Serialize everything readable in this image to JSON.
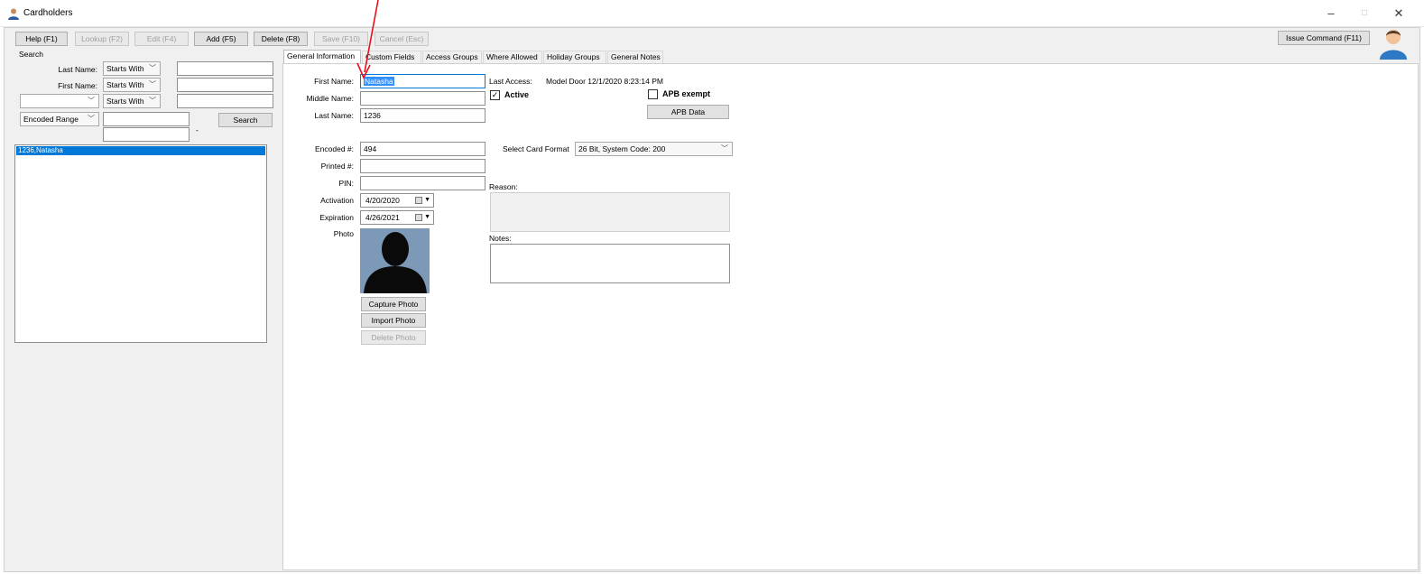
{
  "window": {
    "title": "Cardholders",
    "minimize": "–",
    "maximize": "□",
    "close": "✕"
  },
  "toolbar": {
    "help": "Help (F1)",
    "lookup": "Lookup (F2)",
    "edit": "Edit (F4)",
    "add": "Add (F5)",
    "delete": "Delete (F8)",
    "save": "Save (F10)",
    "cancel": "Cancel (Esc)",
    "issue_command": "Issue Command (F11)"
  },
  "search": {
    "group_label": "Search",
    "last_name_label": "Last Name:",
    "first_name_label": "First Name:",
    "starts_with": "Starts With",
    "encoded_range": "Encoded Range",
    "range_dash": "-",
    "search_button": "Search",
    "results": [
      "1236,Natasha"
    ]
  },
  "tabs": [
    "General Information",
    "Custom Fields",
    "Access Groups",
    "Where Allowed",
    "Holiday Groups",
    "General Notes"
  ],
  "form": {
    "first_name_label": "First Name:",
    "first_name_value": "Natasha",
    "middle_name_label": "Middle Name:",
    "middle_name_value": "",
    "last_name_label": "Last Name:",
    "last_name_value": "1236",
    "encoded_label": "Encoded #:",
    "encoded_value": "494",
    "printed_label": "Printed #:",
    "printed_value": "",
    "pin_label": "PIN:",
    "pin_value": "",
    "activation_label": "Activation",
    "activation_value": "4/20/2020",
    "expiration_label": "Expiration",
    "expiration_value": "4/26/2021",
    "photo_label": "Photo",
    "capture_photo": "Capture Photo",
    "import_photo": "Import Photo",
    "delete_photo": "Delete Photo",
    "last_access_label": "Last Access:",
    "last_access_value": "Model Door 12/1/2020 8:23:14 PM",
    "active_label": "Active",
    "active_checked": true,
    "apb_exempt_label": "APB exempt",
    "apb_exempt_checked": false,
    "apb_data_button": "APB Data",
    "select_card_format_label": "Select Card Format",
    "card_format_value": "26 Bit, System Code: 200",
    "reason_label": "Reason:",
    "notes_label": "Notes:"
  },
  "colors": {
    "selection": "#0078d7",
    "annotation_arrow": "#e8101e",
    "photo_background": "#7c99b8"
  }
}
